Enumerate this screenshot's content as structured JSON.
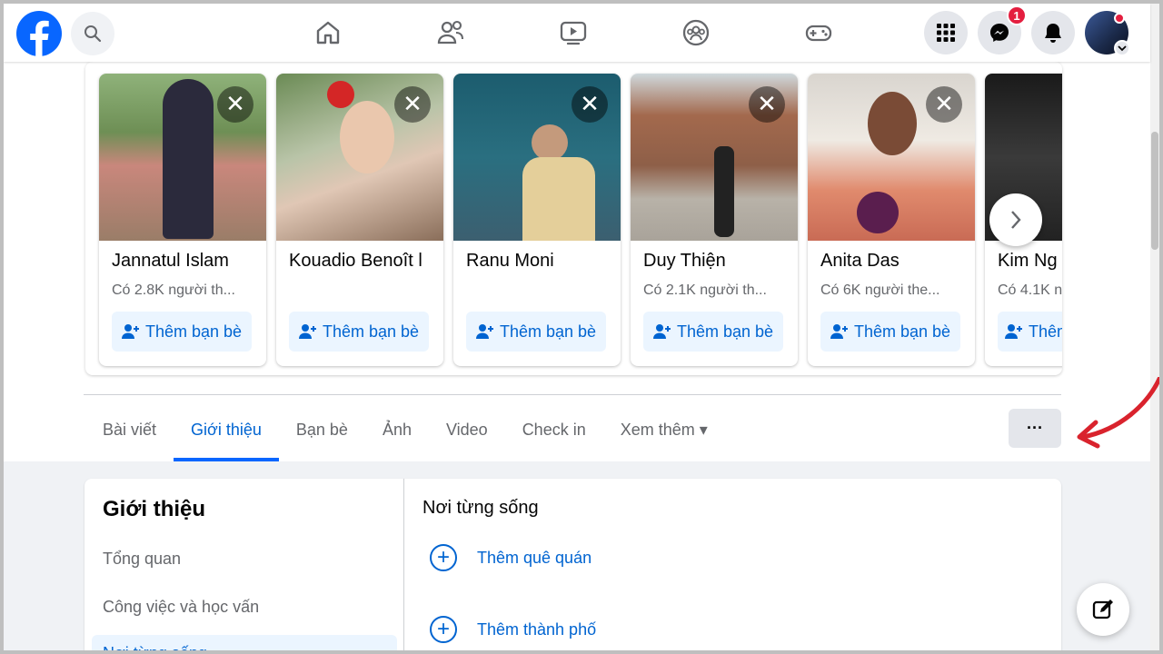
{
  "nav": {
    "messenger_badge": "1"
  },
  "suggestions": [
    {
      "name": "Jannatul Islam",
      "mutual": "Có 2.8K người th...",
      "button": "Thêm bạn bè",
      "close": "✕"
    },
    {
      "name": "Kouadio Benoît l",
      "mutual": "",
      "button": "Thêm bạn bè",
      "close": "✕"
    },
    {
      "name": "Ranu Moni",
      "mutual": "",
      "button": "Thêm bạn bè",
      "close": "✕"
    },
    {
      "name": "Duy Thiện",
      "mutual": "Có 2.1K người th...",
      "button": "Thêm bạn bè",
      "close": "✕"
    },
    {
      "name": "Anita Das",
      "mutual": "Có 6K người the...",
      "button": "Thêm bạn bè",
      "close": "✕"
    },
    {
      "name": "Kim Ng",
      "mutual": "Có 4.1K n",
      "button": "Thêm",
      "close": ""
    }
  ],
  "tabs": [
    {
      "label": "Bài viết"
    },
    {
      "label": "Giới thiệu"
    },
    {
      "label": "Bạn bè"
    },
    {
      "label": "Ảnh"
    },
    {
      "label": "Video"
    },
    {
      "label": "Check in"
    },
    {
      "label": "Xem thêm ▾"
    }
  ],
  "more_button": "···",
  "about": {
    "title": "Giới thiệu",
    "menu": [
      "Tổng quan",
      "Công việc và học vấn",
      "Nơi từng sống"
    ],
    "section_title": "Nơi từng sống",
    "add_hometown": "Thêm quê quán",
    "add_city": "Thêm thành phố"
  },
  "colors": {
    "accent": "#0866ff",
    "link": "#0064d1",
    "badge": "#e41e3f"
  }
}
